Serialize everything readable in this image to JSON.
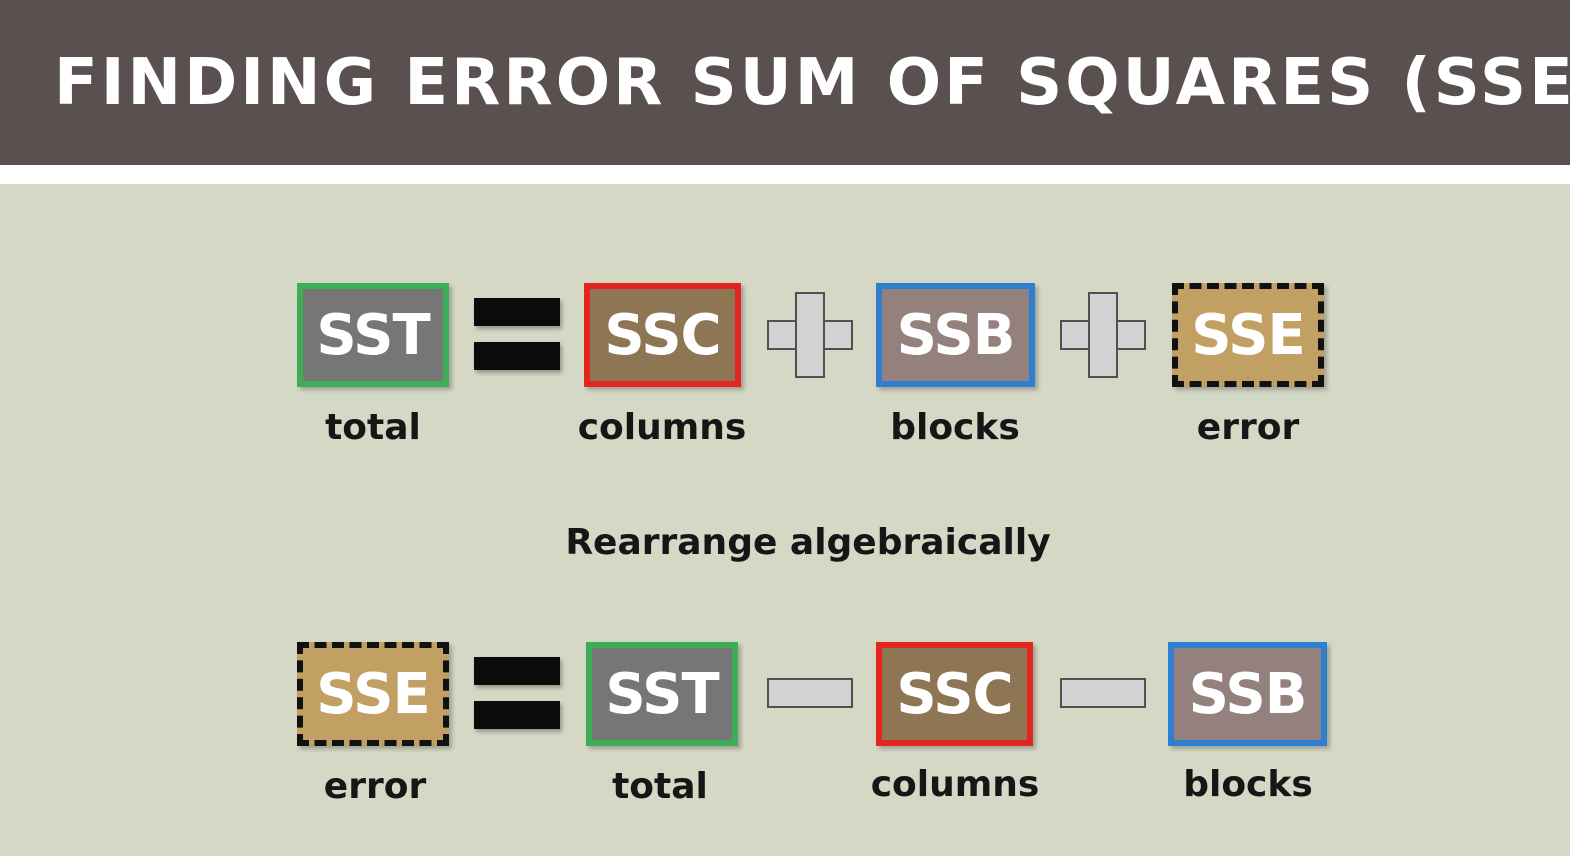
{
  "header": {
    "title": "FINDING ERROR SUM OF SQUARES (SSE)"
  },
  "colors": {
    "header_bg": "#5a5050",
    "canvas_bg": "#d5d8c5",
    "sst_fill": "#767677",
    "sst_border": "#3dae55",
    "ssc_fill": "#8e7553",
    "ssc_border": "#e2251f",
    "ssb_fill": "#94817d",
    "ssb_border": "#2f7fd0",
    "sse_fill": "#c2a063",
    "sse_border": "#111111"
  },
  "equation1": {
    "terms": [
      {
        "symbol": "SST",
        "label": "total"
      },
      {
        "symbol": "SSC",
        "label": "columns"
      },
      {
        "symbol": "SSB",
        "label": "blocks"
      },
      {
        "symbol": "SSE",
        "label": "error"
      }
    ],
    "operators": [
      "equals-icon",
      "plus-icon",
      "plus-icon"
    ]
  },
  "subtitle": "Rearrange algebraically",
  "equation2": {
    "terms": [
      {
        "symbol": "SSE",
        "label": "error"
      },
      {
        "symbol": "SST",
        "label": "total"
      },
      {
        "symbol": "SSC",
        "label": "columns"
      },
      {
        "symbol": "SSB",
        "label": "blocks"
      }
    ],
    "operators": [
      "equals-icon",
      "minus-icon",
      "minus-icon"
    ]
  }
}
